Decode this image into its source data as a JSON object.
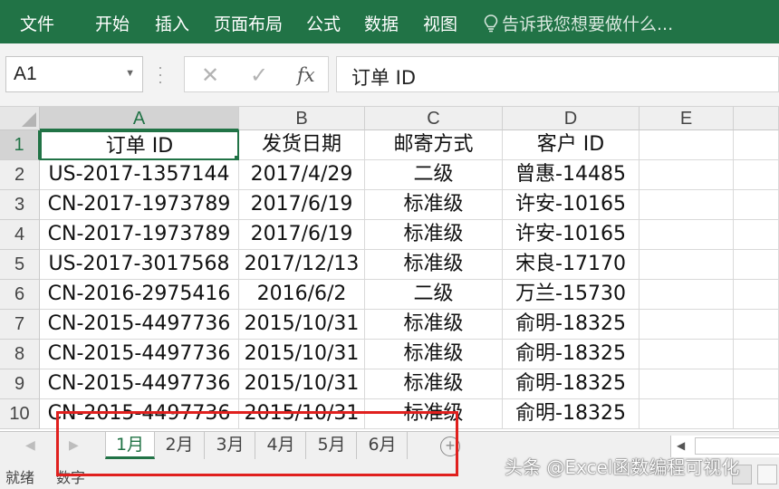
{
  "ribbon": {
    "tabs": [
      "文件",
      "开始",
      "插入",
      "页面布局",
      "公式",
      "数据",
      "视图"
    ],
    "tell_me": "告诉我您想要做什么...",
    "bg_color": "#217346"
  },
  "formula_bar": {
    "name_box": "A1",
    "cancel_icon": "✕",
    "enter_icon": "✓",
    "fx_label": "fx",
    "content": "订单 ID"
  },
  "grid": {
    "columns": [
      "A",
      "B",
      "C",
      "D",
      "E"
    ],
    "row_numbers": [
      "1",
      "2",
      "3",
      "4",
      "5",
      "6",
      "7",
      "8",
      "9",
      "10"
    ],
    "rows": [
      [
        "订单 ID",
        "发货日期",
        "邮寄方式",
        "客户 ID"
      ],
      [
        "US-2017-1357144",
        "2017/4/29",
        "二级",
        "曾惠-14485"
      ],
      [
        "CN-2017-1973789",
        "2017/6/19",
        "标准级",
        "许安-10165"
      ],
      [
        "CN-2017-1973789",
        "2017/6/19",
        "标准级",
        "许安-10165"
      ],
      [
        "US-2017-3017568",
        "2017/12/13",
        "标准级",
        "宋良-17170"
      ],
      [
        "CN-2016-2975416",
        "2016/6/2",
        "二级",
        "万兰-15730"
      ],
      [
        "CN-2015-4497736",
        "2015/10/31",
        "标准级",
        "俞明-18325"
      ],
      [
        "CN-2015-4497736",
        "2015/10/31",
        "标准级",
        "俞明-18325"
      ],
      [
        "CN-2015-4497736",
        "2015/10/31",
        "标准级",
        "俞明-18325"
      ],
      [
        "CN-2015-4497736",
        "2015/10/31",
        "标准级",
        "俞明-18325"
      ]
    ]
  },
  "sheet_tabs": [
    "1月",
    "2月",
    "3月",
    "4月",
    "5月",
    "6月"
  ],
  "active_sheet": "1月",
  "add_sheet": "+",
  "status": {
    "ready": "就绪",
    "mode": "数字"
  },
  "watermark": "头条 @Excel函数编程可视化",
  "highlight_color": "#e0201e"
}
